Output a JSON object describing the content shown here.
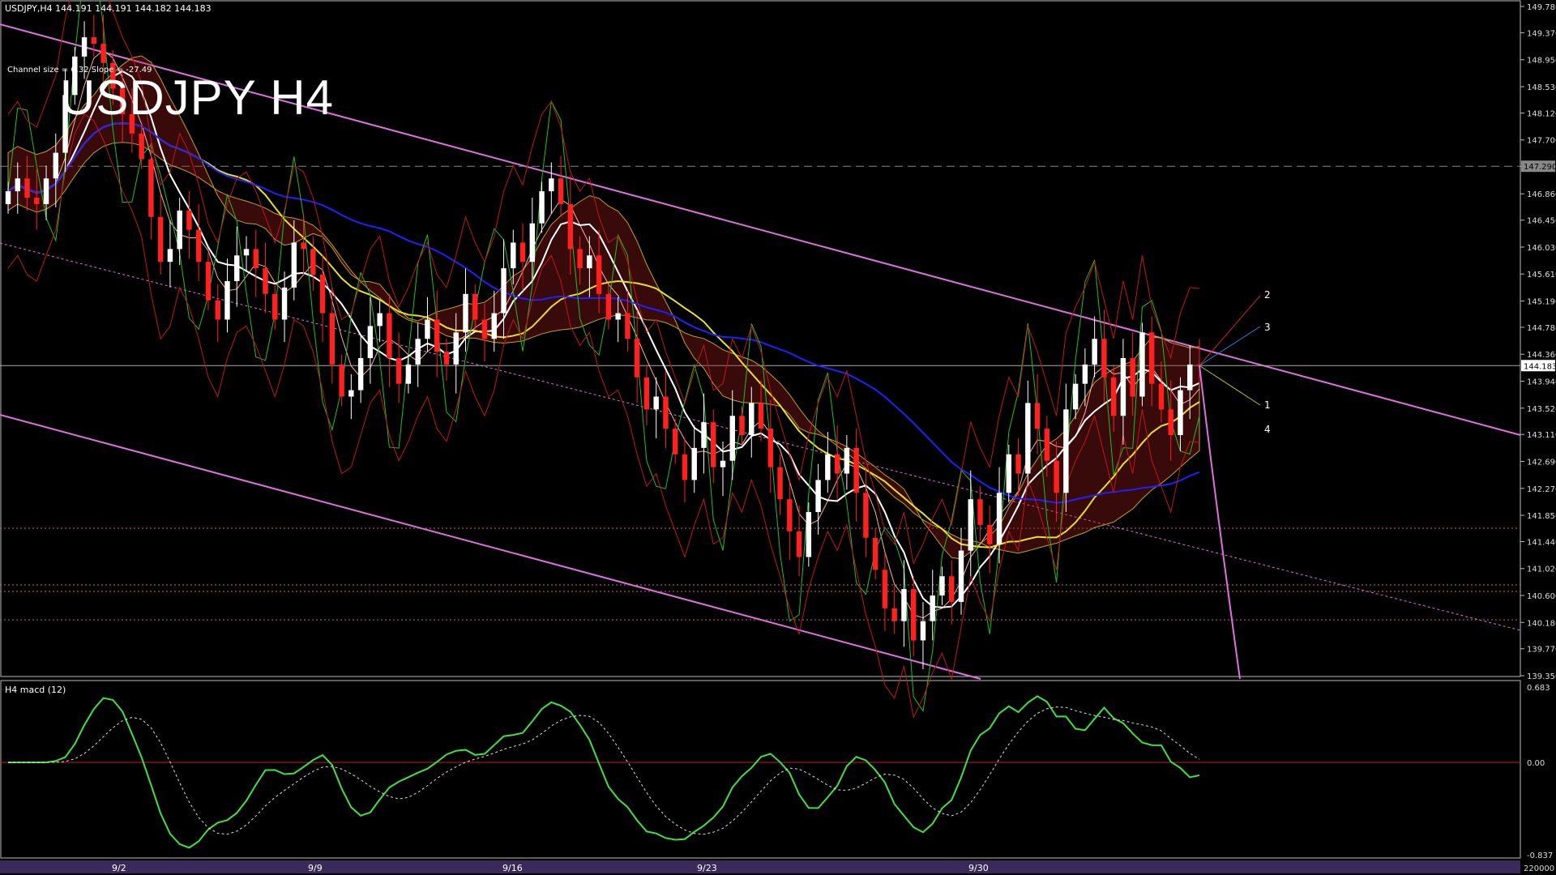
{
  "header": {
    "symbol_line": "USDJPY,H4  144.191 144.191 144.182 144.183",
    "channel_text": "Channel size = 6.32 Slope = -27.49",
    "title": "USDJPY H4"
  },
  "macd": {
    "label": "H4  macd (12)",
    "scale": [
      "0.683",
      "0.00",
      "-0.837"
    ],
    "bottom_value": "220000"
  },
  "colors": {
    "background": "#000000",
    "bull_candle": "#ffffff",
    "bear_candle": "#ff2020",
    "channel": "#e070e0",
    "ma_white": "#ffffff",
    "ma_blue": "#2020ff",
    "ma_yellow": "#e8e020",
    "green_line": "#20c020",
    "macd_green": "#40e040",
    "macd_pink": "#f08090",
    "cloud_red": "#cc2020",
    "cloud_blue": "#4060ff"
  },
  "chart_data": {
    "type": "candlestick",
    "symbol": "USDJPY",
    "timeframe": "H4",
    "y_ticks": [
      "149.780",
      "149.370",
      "148.950",
      "148.530",
      "148.120",
      "147.700",
      "147.290",
      "146.860",
      "146.450",
      "146.030",
      "145.610",
      "145.190",
      "144.780",
      "144.360",
      "143.940",
      "143.520",
      "143.110",
      "142.690",
      "142.270",
      "141.850",
      "141.440",
      "141.020",
      "140.600",
      "140.180",
      "139.770",
      "139.350"
    ],
    "ylim": [
      139.35,
      149.78
    ],
    "x_labels": [
      "9/2",
      "9/9",
      "9/16",
      "9/23",
      "9/30"
    ],
    "current_price": "144.183",
    "level_147": "147.290",
    "closes": [
      146.9,
      147.1,
      146.8,
      146.7,
      147.1,
      147.5,
      148.4,
      149.0,
      149.3,
      149.2,
      148.9,
      148.5,
      148.1,
      147.8,
      147.4,
      146.5,
      145.8,
      146.0,
      146.6,
      146.3,
      145.8,
      145.2,
      144.9,
      145.5,
      145.9,
      146.0,
      145.7,
      145.3,
      144.9,
      145.4,
      146.1,
      146.0,
      145.6,
      145.0,
      144.2,
      143.7,
      143.8,
      144.3,
      144.8,
      145.0,
      144.3,
      143.9,
      144.2,
      144.6,
      144.9,
      144.4,
      144.2,
      144.7,
      145.3,
      144.9,
      144.6,
      145.0,
      145.7,
      146.1,
      145.8,
      146.4,
      146.9,
      147.1,
      146.7,
      146.0,
      145.7,
      145.9,
      145.3,
      144.9,
      145.0,
      144.6,
      144.0,
      143.5,
      143.7,
      143.2,
      142.8,
      142.4,
      142.9,
      143.3,
      142.6,
      142.7,
      143.4,
      143.1,
      143.6,
      143.2,
      142.6,
      142.1,
      141.6,
      141.2,
      141.9,
      142.4,
      142.8,
      142.5,
      142.9,
      142.2,
      141.5,
      141.0,
      140.4,
      140.2,
      140.7,
      139.9,
      140.2,
      140.6,
      140.9,
      140.5,
      141.3,
      142.1,
      141.7,
      141.4,
      142.2,
      142.8,
      142.5,
      143.6,
      143.2,
      142.7,
      142.2,
      143.5,
      143.9,
      144.2,
      144.6,
      144.0,
      143.4,
      144.3,
      143.7,
      144.7,
      143.9,
      143.5,
      143.1,
      143.8,
      144.2,
      144.183
    ]
  }
}
